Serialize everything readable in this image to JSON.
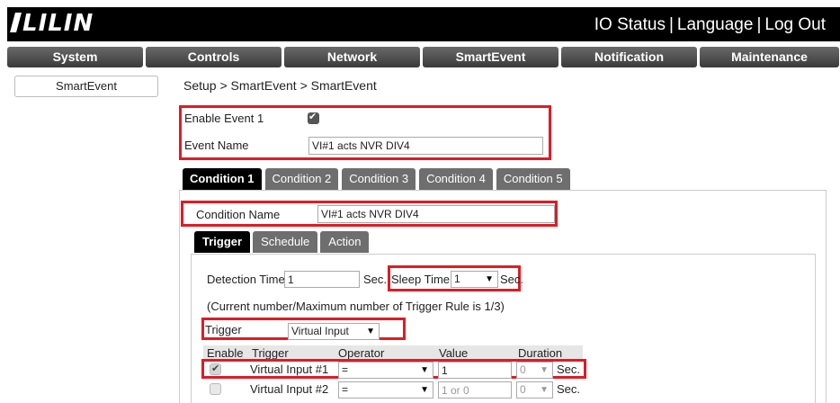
{
  "header": {
    "logo": "LILIN",
    "links": [
      "IO Status",
      "Language",
      "Log Out"
    ]
  },
  "nav": {
    "tabs": [
      "System",
      "Controls",
      "Network",
      "SmartEvent",
      "Notification",
      "Maintenance"
    ]
  },
  "sidebar": {
    "items": [
      "SmartEvent"
    ]
  },
  "breadcrumb": "Setup > SmartEvent > SmartEvent",
  "event": {
    "enable_label": "Enable Event 1",
    "enable_checked": true,
    "name_label": "Event Name",
    "name_value": "VI#1 acts NVR DIV4"
  },
  "condition_tabs": [
    "Condition 1",
    "Condition 2",
    "Condition 3",
    "Condition 4",
    "Condition 5"
  ],
  "condition": {
    "name_label": "Condition Name",
    "name_value": "VI#1 acts NVR DIV4"
  },
  "sub_tabs": [
    "Trigger",
    "Schedule",
    "Action"
  ],
  "trigger": {
    "detection_label": "Detection Time",
    "detection_value": "1",
    "sec_label": "Sec.",
    "sleep_label": "Sleep Time",
    "sleep_value": "1",
    "sleep_sec_label": "Sec.",
    "rule_note": "(Current number/Maximum number of Trigger Rule is 1/3)",
    "trigger_label": "Trigger",
    "trigger_value": "Virtual Input"
  },
  "table": {
    "headers": [
      "Enable",
      "Trigger",
      "Operator",
      "Value",
      "Duration"
    ],
    "rows": [
      {
        "enabled": true,
        "trigger": "Virtual Input #1",
        "operator": "=",
        "value": "1",
        "duration": "0",
        "unit": "Sec."
      },
      {
        "enabled": false,
        "trigger": "Virtual Input #2",
        "operator": "=",
        "value": "1 or 0",
        "duration": "0",
        "unit": "Sec."
      }
    ]
  },
  "colors": {
    "highlight": "#e01b24",
    "active_tab": "#000000",
    "tab": "#6e6e6e"
  }
}
